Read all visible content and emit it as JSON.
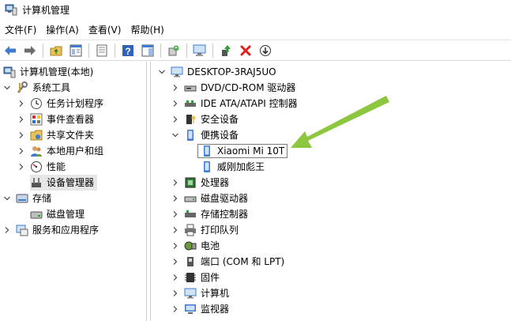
{
  "window": {
    "title": "计算机管理"
  },
  "menu": [
    "文件(F)",
    "操作(A)",
    "查看(V)",
    "帮助(H)"
  ],
  "toolbar": {
    "icons": [
      "back-arrow-icon",
      "forward-arrow-icon",
      "up-folder-icon",
      "show-hide-console-tree-icon",
      "properties-icon",
      "help-icon",
      "action-pane-icon",
      "update-driver-icon",
      "scan-hardware-icon",
      "enable-device-icon",
      "uninstall-icon",
      "disable-device-icon"
    ]
  },
  "left_tree": {
    "root": "计算机管理(本地)",
    "system_tools": "系统工具",
    "task_scheduler": "任务计划程序",
    "event_viewer": "事件查看器",
    "shared_folders": "共享文件夹",
    "local_users": "本地用户和组",
    "performance": "性能",
    "device_manager": "设备管理器",
    "storage": "存储",
    "disk_management": "磁盘管理",
    "services": "服务和应用程序"
  },
  "device_tree": {
    "computer": "DESKTOP-3RAJ5UO",
    "dvd": "DVD/CD-ROM 驱动器",
    "ide": "IDE ATA/ATAPI 控制器",
    "security": "安全设备",
    "portable": "便携设备",
    "portable_child_1": "Xiaomi Mi 10T",
    "portable_child_2": "威刚加彪王",
    "processor": "处理器",
    "disk_drives": "磁盘驱动器",
    "storage_controllers": "存储控制器",
    "print_queue": "打印队列",
    "battery": "电池",
    "ports": "端口 (COM 和 LPT)",
    "firmware": "固件",
    "computer_cat": "计算机",
    "monitors": "监视器"
  },
  "annotation": {
    "arrow_color": "#8dc63f"
  }
}
